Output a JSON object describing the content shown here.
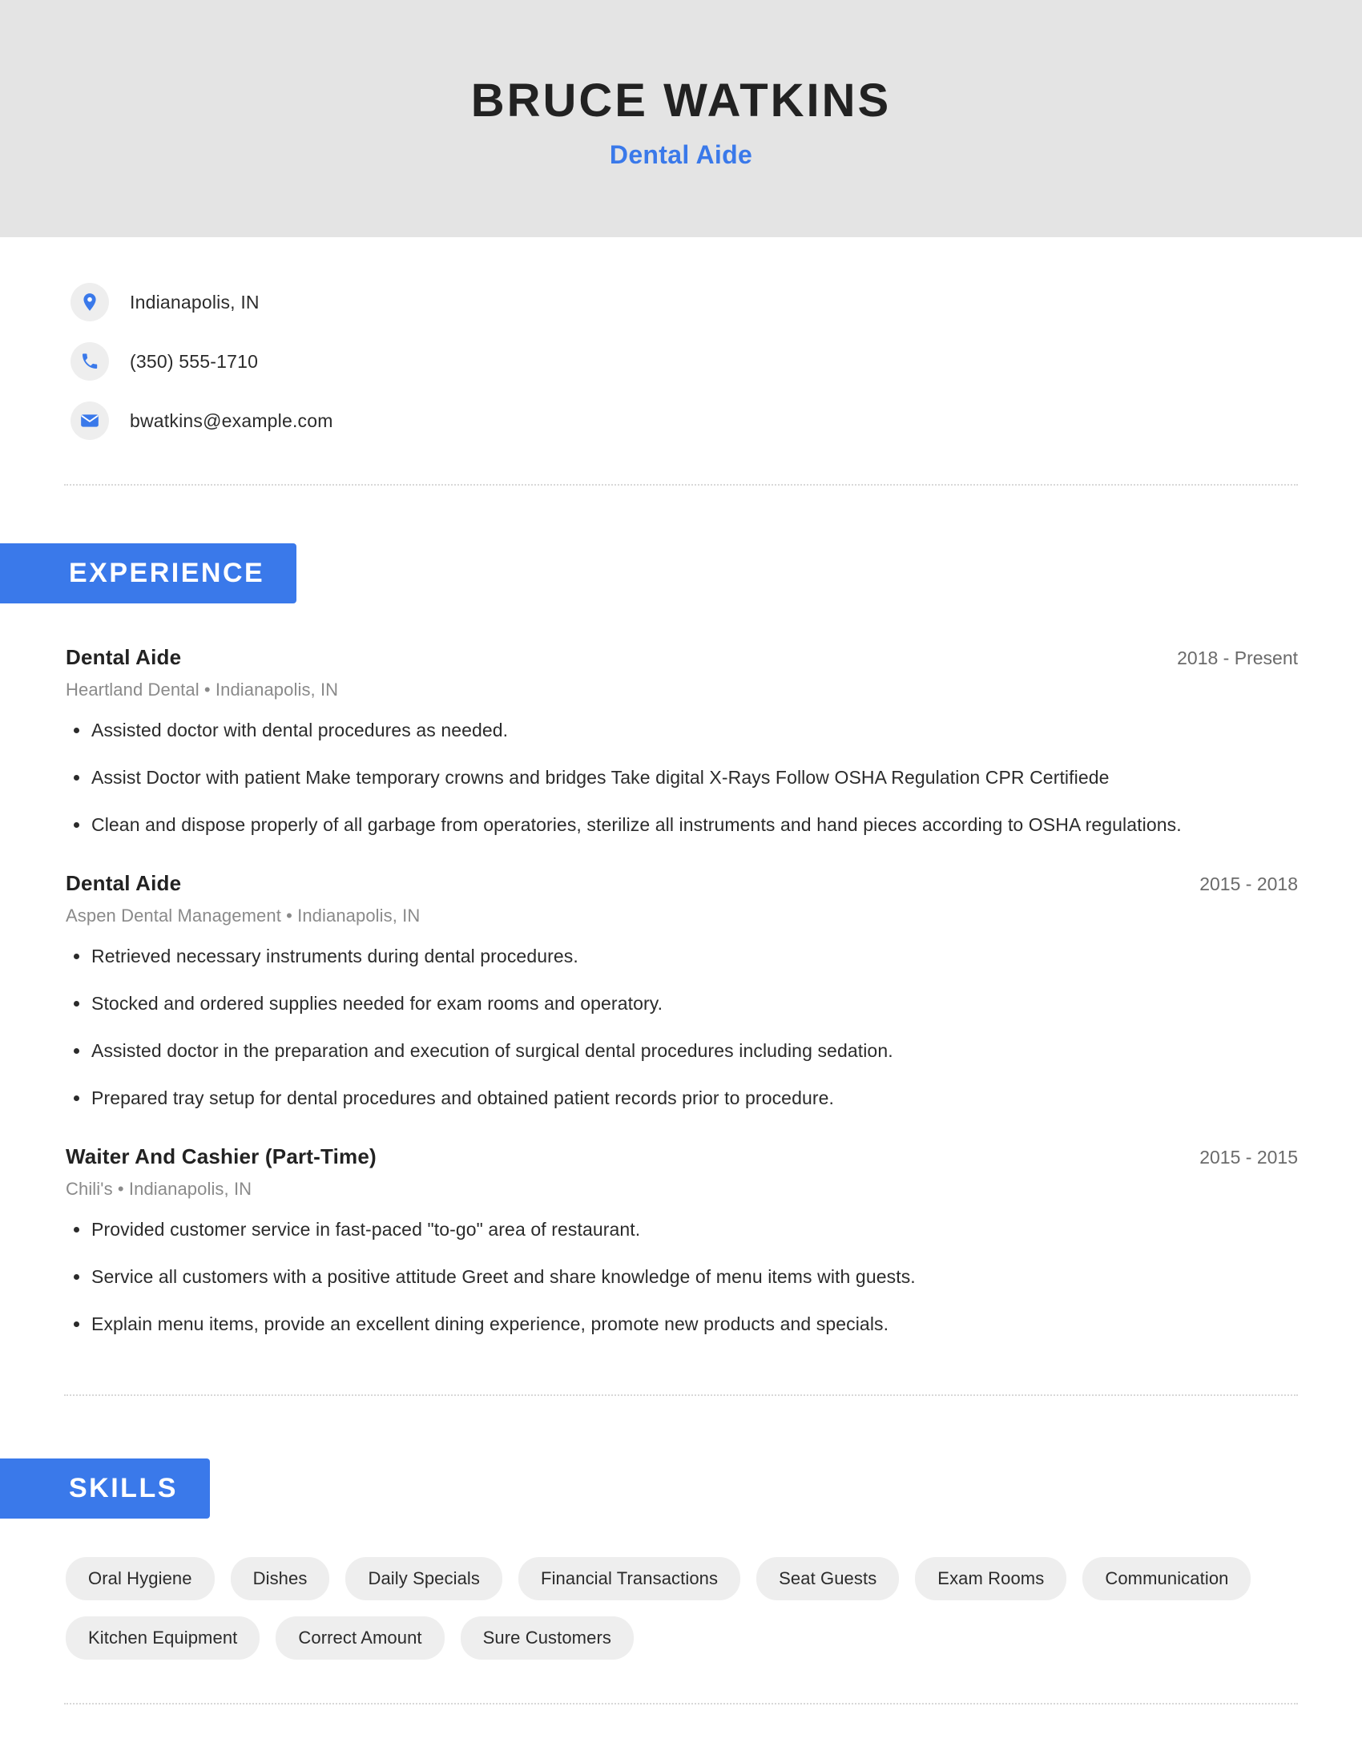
{
  "header": {
    "name": "BRUCE WATKINS",
    "job_title": "Dental Aide",
    "background_color": "#e4e4e4",
    "accent_color": "#3a79ea"
  },
  "contact": {
    "location": "Indianapolis, IN",
    "phone": "(350) 555-1710",
    "email": "bwatkins@example.com",
    "icons": {
      "location": "location-pin-icon",
      "phone": "phone-icon",
      "email": "envelope-icon"
    }
  },
  "experience": {
    "section_label": "EXPERIENCE",
    "entries": [
      {
        "role": "Dental Aide",
        "dates": "2018 - Present",
        "organization": "Heartland Dental  •  Indianapolis, IN",
        "bullets": [
          "Assisted doctor with dental procedures as needed.",
          "Assist Doctor with patient Make temporary crowns and bridges Take digital X-Rays Follow OSHA Regulation CPR Certifiede",
          "Clean and dispose properly of all garbage from operatories, sterilize all instruments and hand pieces according to OSHA regulations."
        ]
      },
      {
        "role": "Dental Aide",
        "dates": "2015 - 2018",
        "organization": "Aspen Dental Management  •  Indianapolis, IN",
        "bullets": [
          "Retrieved necessary instruments during dental procedures.",
          "Stocked and ordered supplies needed for exam rooms and operatory.",
          "Assisted doctor in the preparation and execution of surgical dental procedures including sedation.",
          "Prepared tray setup for dental procedures and obtained patient records prior to procedure."
        ]
      },
      {
        "role": "Waiter And Cashier (Part-Time)",
        "dates": "2015 - 2015",
        "organization": "Chili's  •  Indianapolis, IN",
        "bullets": [
          "Provided customer service in fast-paced \"to-go\" area of restaurant.",
          "Service all customers with a positive attitude Greet and share knowledge of menu items with guests.",
          "Explain menu items, provide an excellent dining experience, promote new products and specials."
        ]
      }
    ]
  },
  "skills": {
    "section_label": "SKILLS",
    "items": [
      "Oral Hygiene",
      "Dishes",
      "Daily Specials",
      "Financial Transactions",
      "Seat Guests",
      "Exam Rooms",
      "Communication",
      "Kitchen Equipment",
      "Correct Amount",
      "Sure Customers"
    ]
  }
}
